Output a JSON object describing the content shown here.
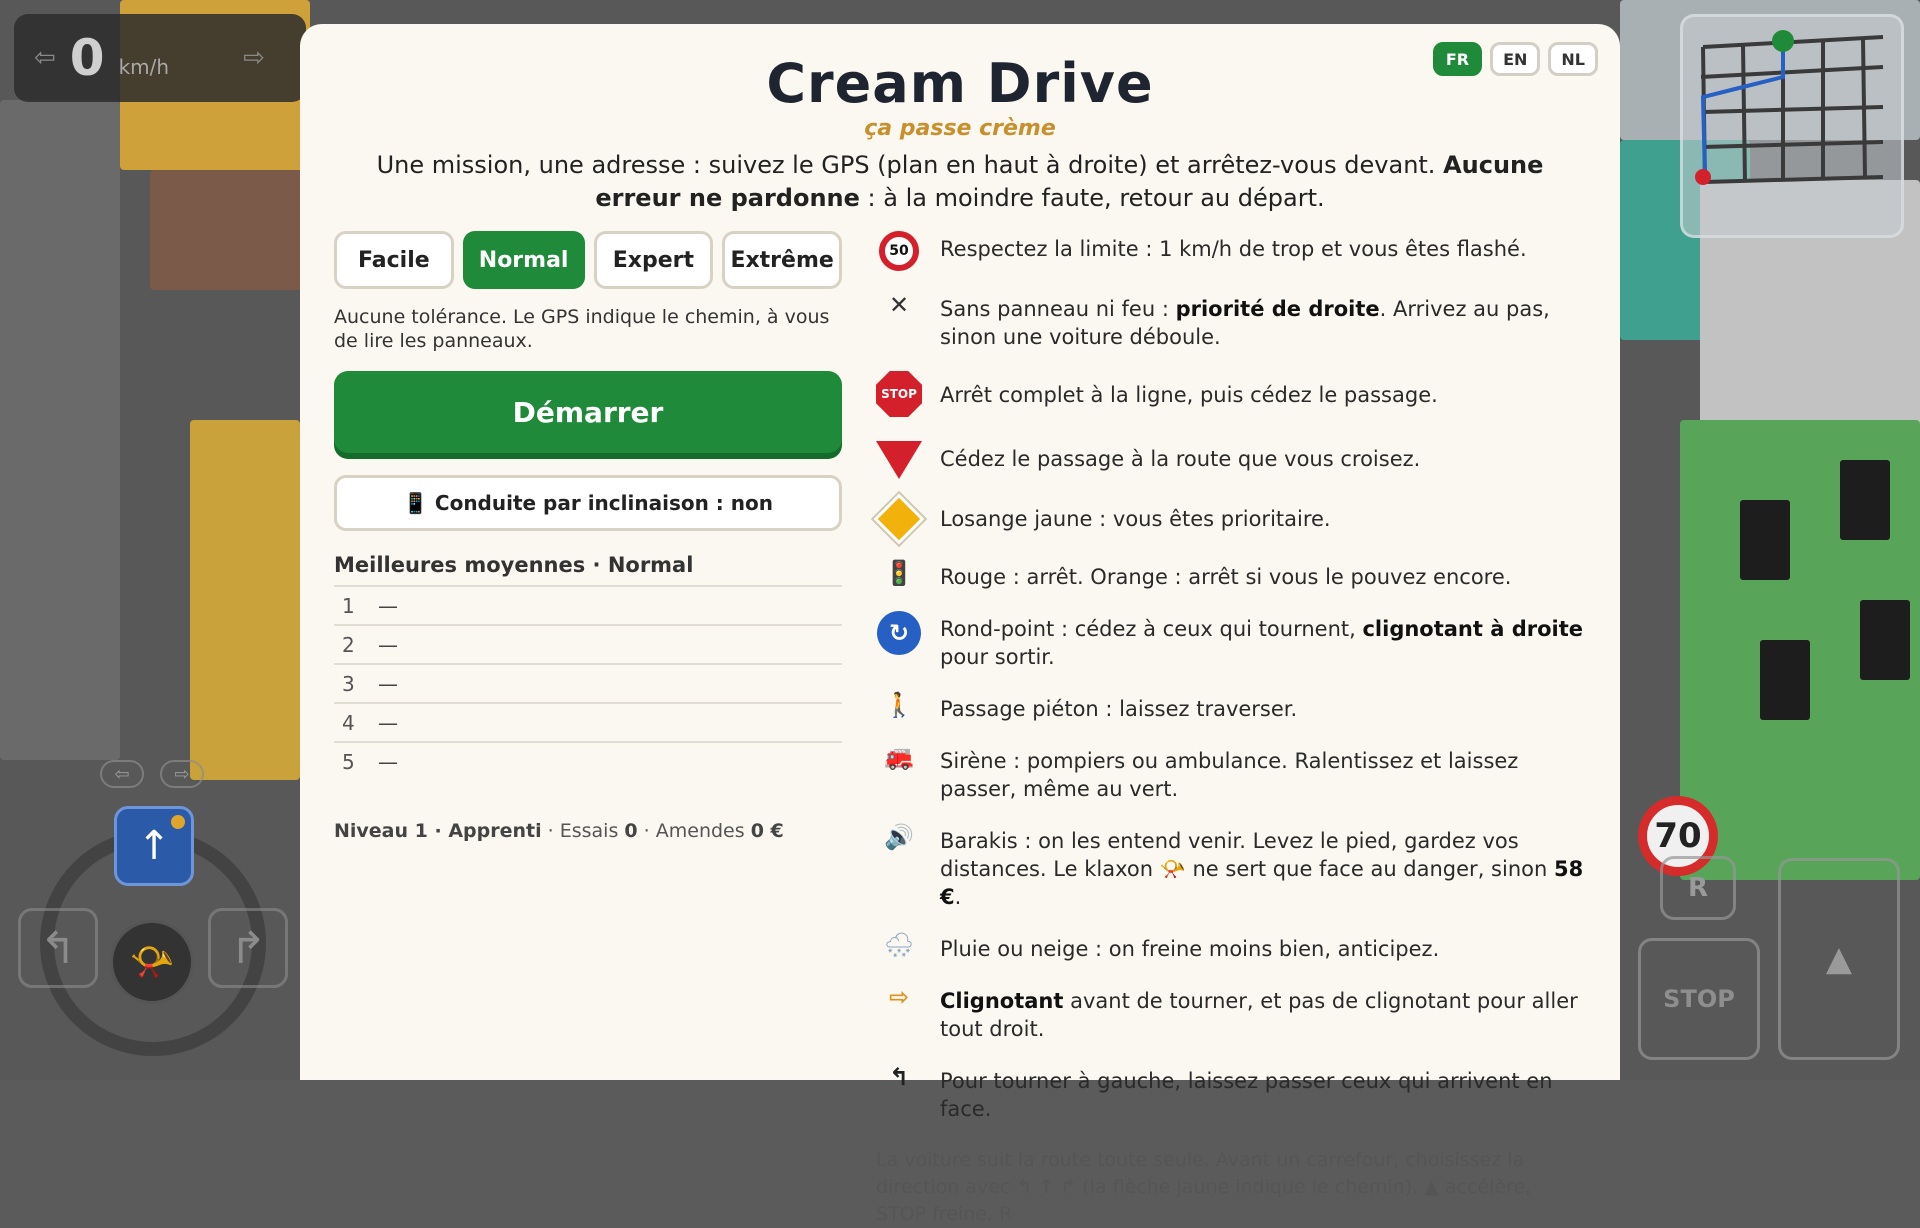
{
  "hud": {
    "speed": "0",
    "speed_unit": "km/h",
    "speed_sign": "70",
    "reverse_label": "R",
    "stop_label": "STOP"
  },
  "languages": [
    "FR",
    "EN",
    "NL"
  ],
  "active_language": "FR",
  "title": "Cream Drive",
  "subtitle": "ça passe crème",
  "intro": {
    "part1": "Une mission, une adresse : suivez le GPS (plan en haut à droite) et arrêtez-vous devant. ",
    "bold": "Aucune erreur ne pardonne",
    "part2": " : à la moindre faute, retour au départ."
  },
  "difficulties": [
    "Facile",
    "Normal",
    "Expert",
    "Extrême"
  ],
  "active_difficulty": "Normal",
  "difficulty_description": "Aucune tolérance. Le GPS indique le chemin, à vous de lire les panneaux.",
  "start_label": "Démarrer",
  "tilt_label": "📱 Conduite par inclinaison : non",
  "best": {
    "title": "Meilleures moyennes · Normal",
    "rows": [
      {
        "rank": "1",
        "value": "—"
      },
      {
        "rank": "2",
        "value": "—"
      },
      {
        "rank": "3",
        "value": "—"
      },
      {
        "rank": "4",
        "value": "—"
      },
      {
        "rank": "5",
        "value": "—"
      }
    ]
  },
  "stats": {
    "level_label": "Niveau 1 · Apprenti",
    "tries_label": " · Essais ",
    "tries_value": "0",
    "fines_label": " · Amendes ",
    "fines_value": "0 €"
  },
  "rules": [
    {
      "icon": "speed-limit-50-icon",
      "icon_text": "50",
      "t1": "Respectez la limite : 1 km/h de trop et vous êtes flashé.",
      "b": "",
      "t2": ""
    },
    {
      "icon": "cross-icon",
      "icon_text": "✕",
      "t1": "Sans panneau ni feu : ",
      "b": "priorité de droite",
      "t2": ". Arrivez au pas, sinon une voiture déboule."
    },
    {
      "icon": "stop-sign-icon",
      "icon_text": "STOP",
      "t1": "Arrêt complet à la ligne, puis cédez le passage.",
      "b": "",
      "t2": ""
    },
    {
      "icon": "yield-sign-icon",
      "icon_text": "",
      "t1": "Cédez le passage à la route que vous croisez.",
      "b": "",
      "t2": ""
    },
    {
      "icon": "priority-diamond-icon",
      "icon_text": "",
      "t1": "Losange jaune : vous êtes prioritaire.",
      "b": "",
      "t2": ""
    },
    {
      "icon": "traffic-light-icon",
      "icon_text": "🚦",
      "t1": "Rouge : arrêt. Orange : arrêt si vous le pouvez encore.",
      "b": "",
      "t2": ""
    },
    {
      "icon": "roundabout-icon",
      "icon_text": "↻",
      "t1": "Rond-point : cédez à ceux qui tournent, ",
      "b": "clignotant à droite",
      "t2": " pour sortir."
    },
    {
      "icon": "pedestrian-icon",
      "icon_text": "🚶",
      "t1": "Passage piéton : laissez traverser.",
      "b": "",
      "t2": ""
    },
    {
      "icon": "fire-truck-icon",
      "icon_text": "🚒",
      "t1": "Sirène : pompiers ou ambulance. Ralentissez et laissez passer, même au vert.",
      "b": "",
      "t2": ""
    },
    {
      "icon": "speaker-icon",
      "icon_text": "🔊",
      "t1": "Barakis : on les entend venir. Levez le pied, gardez vos distances. Le klaxon 📯 ne sert que face au danger, sinon ",
      "b": "58 €",
      "t2": "."
    },
    {
      "icon": "rain-snow-icon",
      "icon_text": "🌨",
      "t1": "Pluie ou neige : on freine moins bien, anticipez.",
      "b": "",
      "t2": ""
    },
    {
      "icon": "blinker-icon",
      "icon_text": "⇨",
      "t1": "",
      "b": "Clignotant",
      "t2": " avant de tourner, et pas de clignotant pour aller tout droit."
    },
    {
      "icon": "turn-left-icon",
      "icon_text": "↰",
      "t1": "Pour tourner à gauche, laissez passer ceux qui arrivent en face.",
      "b": "",
      "t2": ""
    }
  ],
  "footnote": "La voiture suit la route toute seule. Avant un carrefour, choisissez la direction avec ↰ ↑ ↱ (la flèche jaune indique le chemin). ▲ accélère, STOP freine, R"
}
